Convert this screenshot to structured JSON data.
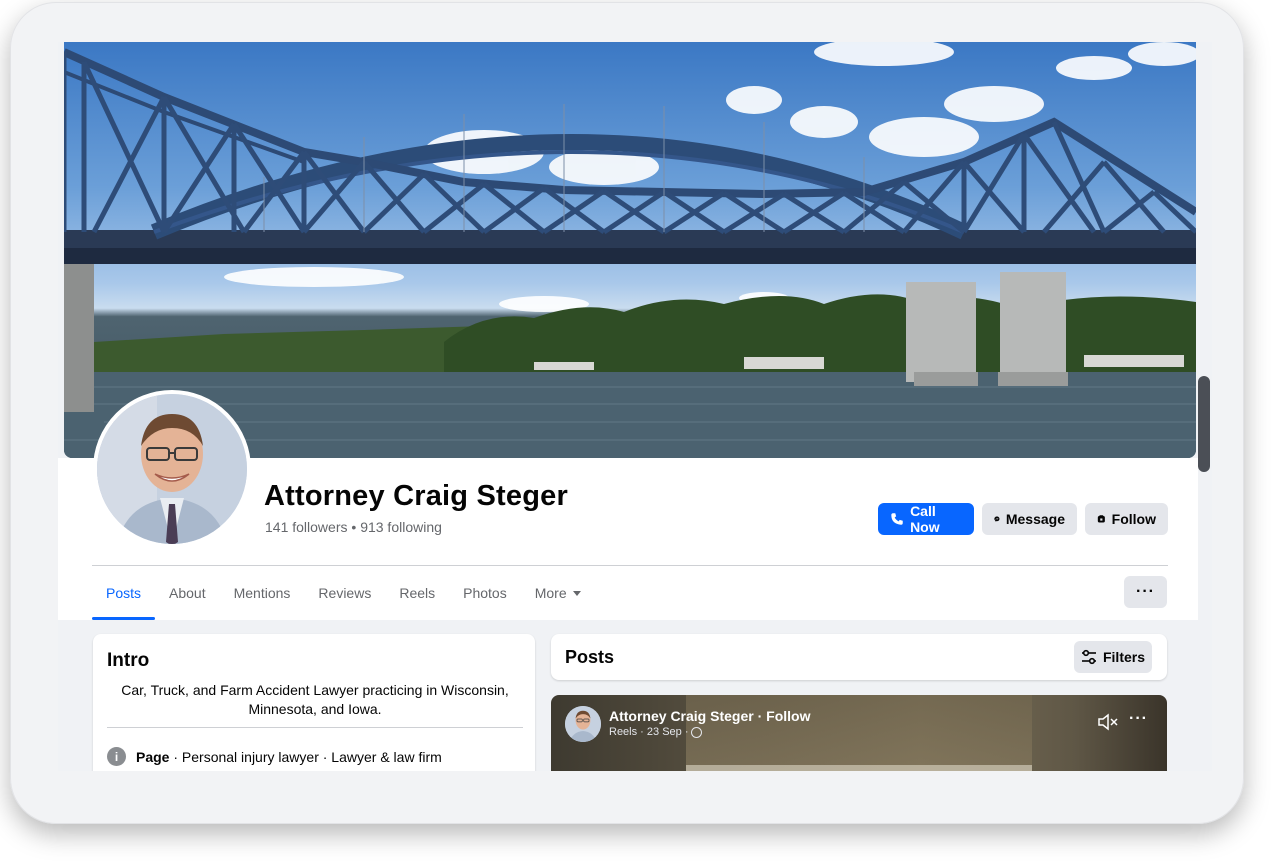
{
  "profile": {
    "name": "Attorney Craig Steger",
    "followers": "141 followers",
    "separator": "•",
    "following": "913 following"
  },
  "actions": {
    "call_now": "Call Now",
    "message": "Message",
    "follow": "Follow"
  },
  "tabs": [
    {
      "label": "Posts",
      "active": true
    },
    {
      "label": "About"
    },
    {
      "label": "Mentions"
    },
    {
      "label": "Reviews"
    },
    {
      "label": "Reels"
    },
    {
      "label": "Photos"
    },
    {
      "label": "More"
    }
  ],
  "overflow_menu": "···",
  "intro": {
    "title": "Intro",
    "bio": "Car, Truck, and Farm Accident Lawyer practicing in Wisconsin, Minnesota, and Iowa.",
    "page_label": "Page",
    "page_category": " · Personal injury lawyer · Lawyer & law firm"
  },
  "posts": {
    "title": "Posts",
    "filters": "Filters"
  },
  "reel_post": {
    "author": "Attorney Craig Steger · Follow",
    "meta": "Reels · 23 Sep ·",
    "more": "···"
  },
  "colors": {
    "primary": "#0866ff",
    "secondary_button": "#e4e6eb",
    "muted_text": "#65676b"
  }
}
